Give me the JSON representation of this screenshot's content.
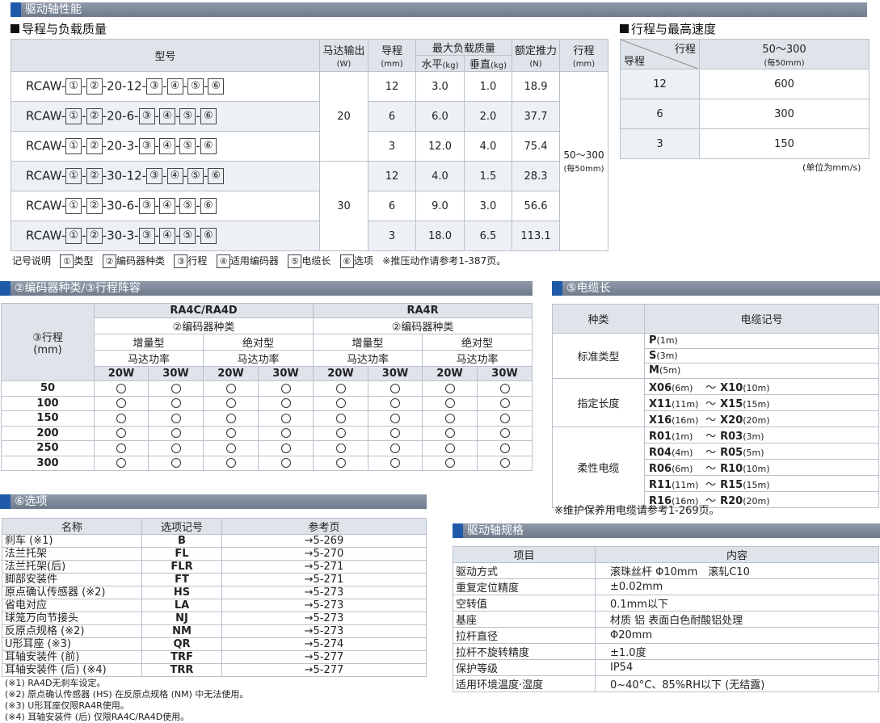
{
  "main_banner": "驱动轴性能",
  "lead_load": {
    "title": "导程与负载质量",
    "headers": {
      "model": "型号",
      "motor": "马达输出",
      "motor_unit": "(W)",
      "lead": "导程",
      "lead_unit": "(mm)",
      "max_load": "最大负载质量",
      "horizontal": "水平",
      "horizontal_unit": "(kg)",
      "vertical": "垂直",
      "vertical_unit": "(kg)",
      "thrust": "额定推力",
      "thrust_unit": "(N)",
      "stroke": "行程",
      "stroke_unit": "(mm)"
    },
    "model_prefix": "RCAW-",
    "box1": "①",
    "box2": "②",
    "box3": "③",
    "box4": "④",
    "box5": "⑤",
    "box6": "⑥",
    "rows": [
      {
        "mid": "-20-12-",
        "lead": "12",
        "h": "3.0",
        "v": "1.0",
        "thrust": "18.9"
      },
      {
        "mid": "-20-6-",
        "lead": "6",
        "h": "6.0",
        "v": "2.0",
        "thrust": "37.7"
      },
      {
        "mid": "-20-3-",
        "lead": "3",
        "h": "12.0",
        "v": "4.0",
        "thrust": "75.4"
      },
      {
        "mid": "-30-12-",
        "lead": "12",
        "h": "4.0",
        "v": "1.5",
        "thrust": "28.3"
      },
      {
        "mid": "-30-6-",
        "lead": "6",
        "h": "9.0",
        "v": "3.0",
        "thrust": "56.6"
      },
      {
        "mid": "-30-3-",
        "lead": "3",
        "h": "18.0",
        "v": "6.5",
        "thrust": "113.1"
      }
    ],
    "motor_20": "20",
    "motor_30": "30",
    "stroke_value": "50～300",
    "stroke_note": "(每50mm)",
    "legend_label": "记号说明",
    "legend": [
      {
        "num": "①",
        "label": "类型"
      },
      {
        "num": "②",
        "label": "编码器种类"
      },
      {
        "num": "③",
        "label": "行程"
      },
      {
        "num": "④",
        "label": "适用编码器"
      },
      {
        "num": "⑤",
        "label": "电缆长"
      },
      {
        "num": "⑥",
        "label": "选项"
      }
    ],
    "legend_note": "※推压动作请参考1-387页。"
  },
  "speed": {
    "title": "行程与最高速度",
    "corner_stroke": "行程",
    "corner_lead": "导程",
    "range": "50～300",
    "range_note": "(每50mm)",
    "rows": [
      {
        "lead": "12",
        "speed": "600"
      },
      {
        "lead": "6",
        "speed": "300"
      },
      {
        "lead": "3",
        "speed": "150"
      }
    ],
    "unit_note": "(单位为mm/s)"
  },
  "encoder": {
    "banner": "②编码器种类/③行程阵容",
    "stroke_header": "③行程",
    "stroke_unit": "(mm)",
    "group1": "RA4C/RA4D",
    "group2": "RA4R",
    "encoder_kind": "②编码器种类",
    "incremental": "增量型",
    "absolute": "绝对型",
    "motor_power": "马达功率",
    "w20": "20W",
    "w30": "30W",
    "strokes": [
      "50",
      "100",
      "150",
      "200",
      "250",
      "300"
    ]
  },
  "cable": {
    "banner": "⑤电缆长",
    "col_type": "种类",
    "col_code": "电缆记号",
    "standard": "标准类型",
    "specified": "指定长度",
    "flex": "柔性电缆",
    "std_rows": [
      {
        "a": "P",
        "al": "(1m)"
      },
      {
        "a": "S",
        "al": "(3m)"
      },
      {
        "a": "M",
        "al": "(5m)"
      }
    ],
    "spec_rows": [
      {
        "a": "X06",
        "al": "(6m)",
        "b": "X10",
        "bl": "(10m)"
      },
      {
        "a": "X11",
        "al": "(11m)",
        "b": "X15",
        "bl": "(15m)"
      },
      {
        "a": "X16",
        "al": "(16m)",
        "b": "X20",
        "bl": "(20m)"
      }
    ],
    "flex_rows": [
      {
        "a": "R01",
        "al": "(1m)",
        "b": "R03",
        "bl": "(3m)"
      },
      {
        "a": "R04",
        "al": "(4m)",
        "b": "R05",
        "bl": "(5m)"
      },
      {
        "a": "R06",
        "al": "(6m)",
        "b": "R10",
        "bl": "(10m)"
      },
      {
        "a": "R11",
        "al": "(11m)",
        "b": "R15",
        "bl": "(15m)"
      },
      {
        "a": "R16",
        "al": "(16m)",
        "b": "R20",
        "bl": "(20m)"
      }
    ],
    "tilde": "～",
    "note": "※维护保养用电缆请参考1-269页。"
  },
  "options": {
    "banner": "⑥选项",
    "col_name": "名称",
    "col_code": "选项记号",
    "col_page": "参考页",
    "rows": [
      {
        "name": "刹车 (※1)",
        "code": "B",
        "page": "→5-269"
      },
      {
        "name": "法兰托架",
        "code": "FL",
        "page": "→5-270"
      },
      {
        "name": "法兰托架(后)",
        "code": "FLR",
        "page": "→5-271"
      },
      {
        "name": "脚部安装件",
        "code": "FT",
        "page": "→5-271"
      },
      {
        "name": "原点确认传感器 (※2)",
        "code": "HS",
        "page": "→5-273"
      },
      {
        "name": "省电对应",
        "code": "LA",
        "page": "→5-273"
      },
      {
        "name": "球笼万向节接头",
        "code": "NJ",
        "page": "→5-273"
      },
      {
        "name": "反原点规格 (※2)",
        "code": "NM",
        "page": "→5-273"
      },
      {
        "name": "U形耳座 (※3)",
        "code": "QR",
        "page": "→5-274"
      },
      {
        "name": "耳轴安装件 (前)",
        "code": "TRF",
        "page": "→5-277"
      },
      {
        "name": "耳轴安装件 (后) (※4)",
        "code": "TRR",
        "page": "→5-277"
      }
    ],
    "notes": [
      "(※1) RA4D无刹车设定。",
      "(※2) 原点确认传感器 (HS) 在反原点规格 (NM) 中无法使用。",
      "(※3) U形耳座仅限RA4R使用。",
      "(※4) 耳轴安装件 (后) 仅限RA4C/RA4D使用。"
    ]
  },
  "spec": {
    "banner": "驱动轴规格",
    "col_item": "项目",
    "col_content": "内容",
    "rows": [
      {
        "item": "驱动方式",
        "content": "滚珠丝杆 Φ10mm　滚轧C10"
      },
      {
        "item": "重复定位精度",
        "content": "±0.02mm"
      },
      {
        "item": "空转值",
        "content": "0.1mm以下"
      },
      {
        "item": "基座",
        "content": "材质 铝 表面白色耐酸铝处理"
      },
      {
        "item": "拉杆直径",
        "content": "Φ20mm"
      },
      {
        "item": "拉杆不旋转精度",
        "content": "±1.0度"
      },
      {
        "item": "保护等级",
        "content": "IP54"
      },
      {
        "item": "适用环境温度·湿度",
        "content": "0~40°C、85%RH以下 (无结露)"
      }
    ]
  }
}
